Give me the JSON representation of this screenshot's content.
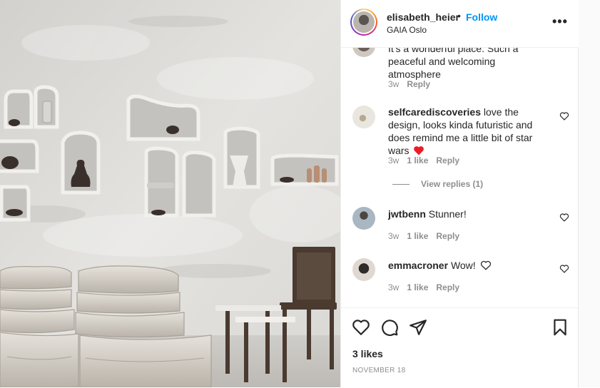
{
  "post": {
    "username": "elisabeth_heier",
    "follow_label": "Follow",
    "separator": "•",
    "location": "GAIA Oslo",
    "more_label": "•••"
  },
  "comments": [
    {
      "username": "",
      "text": "It's a wonderful place. Such a peaceful and welcoming atmosphere",
      "time": "3w",
      "likes": "",
      "reply_label": "Reply"
    },
    {
      "username": "selfcarediscoveries",
      "text": "love the design, looks kinda futuristic and does remind me a little bit of star wars",
      "emoji": "heart-emoji",
      "time": "3w",
      "likes": "1 like",
      "reply_label": "Reply",
      "view_replies": "View replies (1)"
    },
    {
      "username": "jwtbenn",
      "text": "Stunner!",
      "time": "3w",
      "likes": "1 like",
      "reply_label": "Reply"
    },
    {
      "username": "emmacroner",
      "text": "Wow!",
      "emoji": "white-heart-emoji",
      "time": "3w",
      "likes": "1 like",
      "reply_label": "Reply"
    }
  ],
  "footer": {
    "likes": "3 likes",
    "date": "NOVEMBER 18"
  },
  "icons": {
    "like": "heart-icon",
    "comment": "comment-icon",
    "share": "share-icon",
    "save": "bookmark-icon"
  },
  "colors": {
    "accent": "#0095f6",
    "text": "#262626",
    "muted": "#8e8e8e",
    "heart_red": "#ed1c24"
  }
}
